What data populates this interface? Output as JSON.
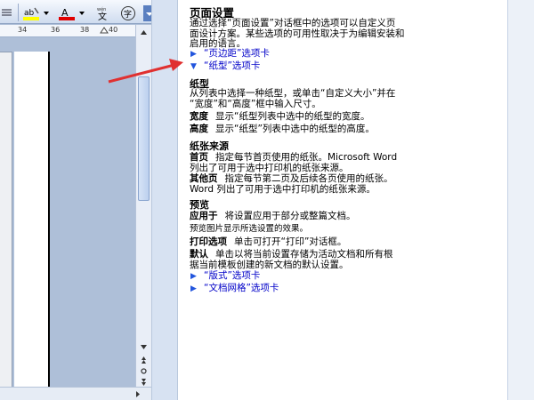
{
  "ruler": {
    "ticks": [
      "34",
      "36",
      "38",
      "40"
    ]
  },
  "toolbar": {
    "highlight_icon": "highlight-icon",
    "font_color_icon": "font-color-icon",
    "phonetic_label": "wén",
    "enclose_label": "字"
  },
  "help": {
    "title": "页面设置",
    "intro_lines": [
      "通过选择“页面设置”对话框中的选项可以自定义页",
      "面设计方案。某些选项的可用性取决于为编辑安装和",
      "启用的语言。"
    ],
    "links_top": [
      {
        "label": "“页边距”选项卡",
        "state": "collapsed"
      },
      {
        "label": "“纸型”选项卡",
        "state": "expanded"
      }
    ],
    "paper_type": {
      "heading": "纸型",
      "desc_lines": [
        "从列表中选择一种纸型，或单击“自定义大小”并在",
        "“宽度”和“高度”框中输入尺寸。"
      ],
      "terms": [
        {
          "term": "宽度",
          "text": "显示“纸型列表中选中的纸型的宽度。"
        },
        {
          "term": "高度",
          "text": "显示“纸型”列表中选中的纸型的高度。"
        }
      ]
    },
    "paper_source": {
      "heading": "纸张来源",
      "items": [
        {
          "term": "首页",
          "lines": [
            "指定每节首页使用的纸张。Microsoft Word",
            "列出了可用于选中打印机的纸张来源。"
          ]
        },
        {
          "term": "其他页",
          "lines": [
            "指定每节第二页及后续各页使用的纸张。",
            "Word 列出了可用于选中打印机的纸张来源。"
          ]
        }
      ]
    },
    "preview": {
      "heading": "预览",
      "apply_term": "应用于",
      "apply_text": "将设置应用于部分或整篇文档。",
      "preview_note": "预览图片显示所选设置的效果。",
      "print_term": "打印选项",
      "print_text": "单击可打开“打印”对话框。",
      "default_term": "默认",
      "default_lines": [
        "单击以将当前设置存储为活动文档和所有根",
        "据当前模板创建的新文档的默认设置。"
      ]
    },
    "links_bottom": [
      {
        "label": "“版式”选项卡"
      },
      {
        "label": "“文档网格”选项卡"
      }
    ]
  },
  "colors": {
    "link": "#0000c8",
    "arrow": "#e03030",
    "word_bg": "#aebfd8"
  }
}
